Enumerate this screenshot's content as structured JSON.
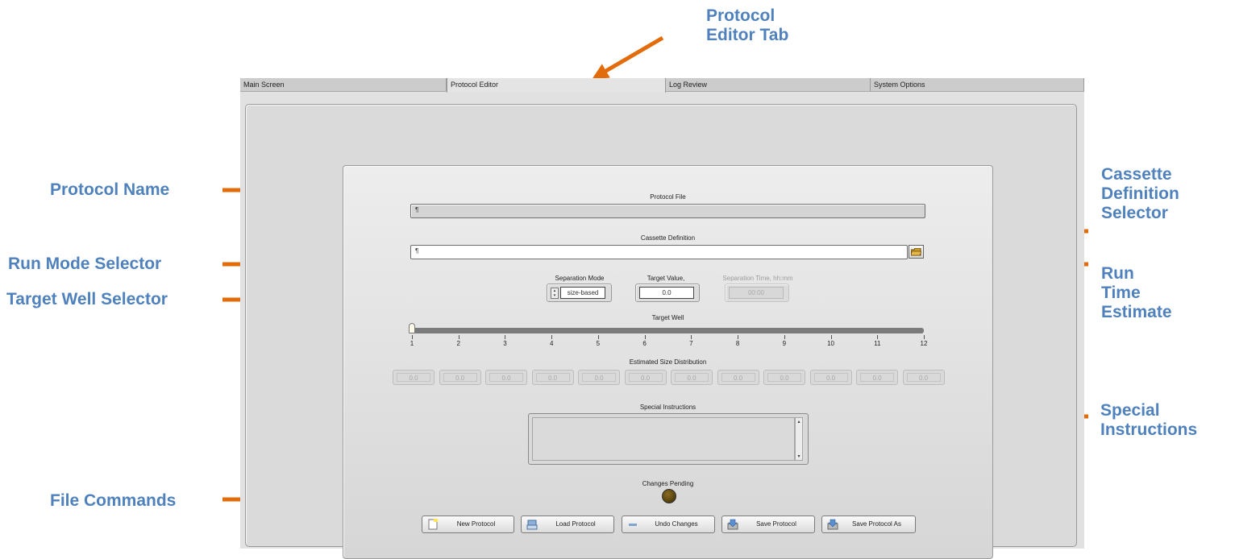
{
  "callouts": {
    "protocol_editor_tab": "Protocol\nEditor Tab",
    "protocol_name": "Protocol Name",
    "run_mode_selector": "Run Mode Selector",
    "target_well_selector": "Target Well Selector",
    "file_commands": "File Commands",
    "cassette_definition_selector": "Cassette\nDefinition\nSelector",
    "run_time_estimate": "Run\nTime\nEstimate",
    "special_instructions": "Special\nInstructions"
  },
  "tabs": [
    {
      "label": "Main Screen"
    },
    {
      "label": "Protocol Editor"
    },
    {
      "label": "Log Review"
    },
    {
      "label": "System Options"
    }
  ],
  "form": {
    "protocol_file_label": "Protocol File",
    "cassette_definition_label": "Cassette Definition",
    "separation_mode_label": "Separation Mode",
    "separation_mode_value": "size-based",
    "target_value_label": "Target Value,",
    "target_value": "0.0",
    "separation_time_label": "Separation Time, hh:mm",
    "separation_time_value": "00:00",
    "target_well_label": "Target Well",
    "target_well_value": 1,
    "target_well_ticks": [
      "1",
      "2",
      "3",
      "4",
      "5",
      "6",
      "7",
      "8",
      "9",
      "10",
      "11",
      "12"
    ],
    "estimated_size_label": "Estimated Size Distribution",
    "estimated_size_values": [
      "0.0",
      "0.0",
      "0.0",
      "0.0",
      "0.0",
      "0.0",
      "0.0",
      "0.0",
      "0.0",
      "0.0",
      "0.0",
      "0.0"
    ],
    "special_instructions_label": "Special Instructions",
    "changes_pending_label": "Changes Pending"
  },
  "buttons": {
    "new_protocol": "New Protocol",
    "load_protocol": "Load Protocol",
    "undo_changes": "Undo Changes",
    "save_protocol": "Save Protocol",
    "save_protocol_as": "Save Protocol As"
  },
  "colors": {
    "callout_text": "#4f81bd",
    "arrow": "#e36c0a",
    "led_off": "#5a4510"
  },
  "icons": {
    "path_icon": "path-icon",
    "folder_icon": "folder-icon",
    "new_icon": "new-document-icon",
    "load_icon": "load-icon",
    "undo_icon": "undo-icon",
    "save_icon": "save-icon",
    "save_as_icon": "save-as-icon"
  }
}
